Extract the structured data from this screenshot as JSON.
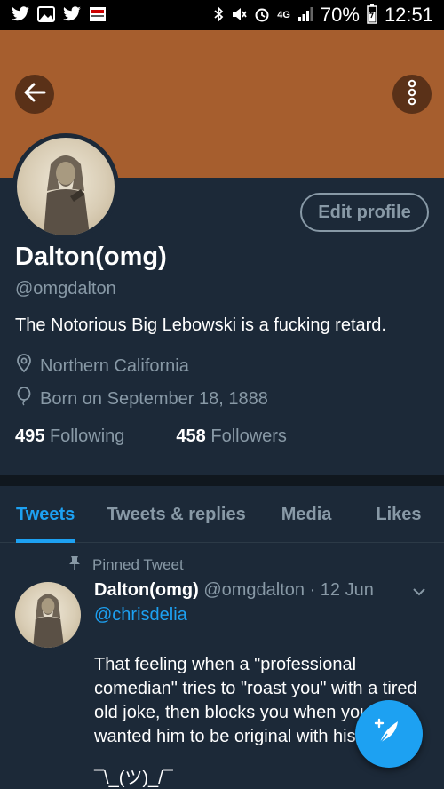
{
  "status_bar": {
    "network": "4G",
    "battery": "70%",
    "time": "12:51"
  },
  "profile": {
    "edit_label": "Edit profile",
    "name": "Dalton(omg)",
    "handle": "@omgdalton",
    "bio": "The Notorious Big Lebowski is a fucking retard.",
    "location": "Northern California",
    "born": "Born on September 18, 1888",
    "following_count": "495",
    "following_label": "Following",
    "followers_count": "458",
    "followers_label": "Followers"
  },
  "tabs": [
    {
      "label": "Tweets",
      "active": true
    },
    {
      "label": "Tweets & replies",
      "active": false
    },
    {
      "label": "Media",
      "active": false
    },
    {
      "label": "Likes",
      "active": false
    }
  ],
  "tweet": {
    "pinned_label": "Pinned Tweet",
    "name": "Dalton(omg)",
    "handle": "@omgdalton",
    "date": "· 12 Jun",
    "mention": "@chrisdelia",
    "text": "That feeling when a \"professional comedian\" tries to \"roast you\" with a tired old joke, then blocks you when you wanted him to be original with his",
    "shrug": "¯\\_(ツ)_/¯"
  },
  "icons": {
    "back": "arrow-left-icon",
    "more": "more-vertical-icon",
    "location": "location-pin-icon",
    "birthday": "balloon-icon",
    "pin": "pin-icon",
    "chevron": "chevron-down-icon",
    "compose": "compose-feather-icon"
  },
  "colors": {
    "banner": "#a65e2e",
    "background": "#1c2938",
    "accent": "#1da1f2",
    "muted": "#8899a6"
  }
}
